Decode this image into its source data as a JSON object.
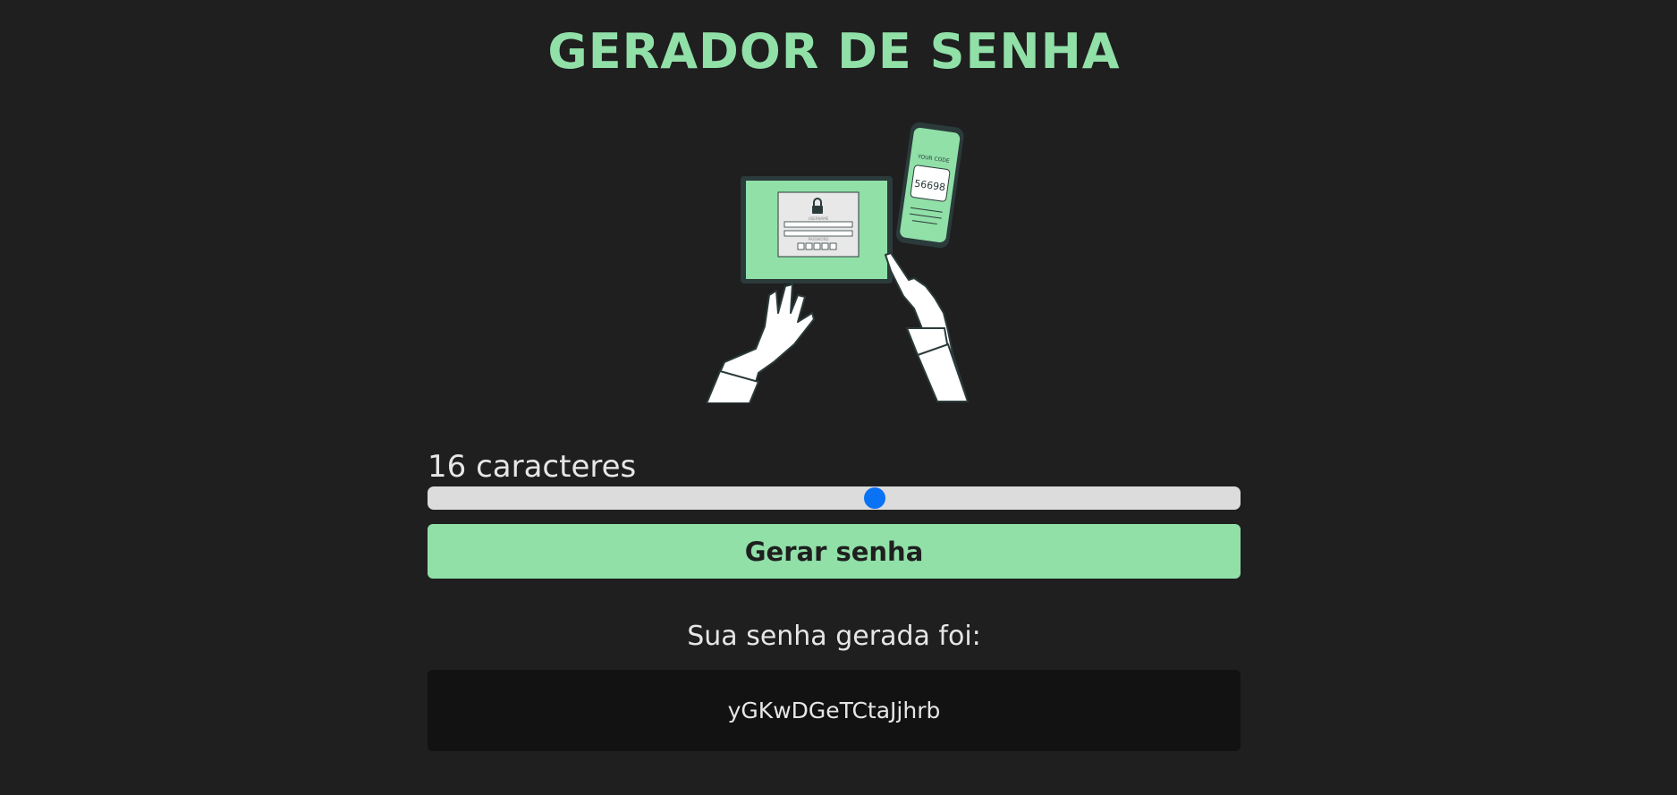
{
  "header": {
    "title": "GERADOR DE SENHA"
  },
  "illustration": {
    "icon": "password-login-illustration",
    "phone_caption": "YOUR CODE",
    "phone_code": "56698",
    "form_username_hint": "USERNAME",
    "form_password_hint": "PASSWORD"
  },
  "generator": {
    "length_label": "16 caracteres",
    "slider_fraction": 0.55,
    "slider_color": "#0a72f5",
    "generate_label": "Gerar senha"
  },
  "result": {
    "label": "Sua senha gerada foi:",
    "password": "yGKwDGeTCtaJjhrb"
  },
  "colors": {
    "accent": "#90e0a8",
    "background": "#1f1f1f",
    "result_background": "#121212"
  }
}
